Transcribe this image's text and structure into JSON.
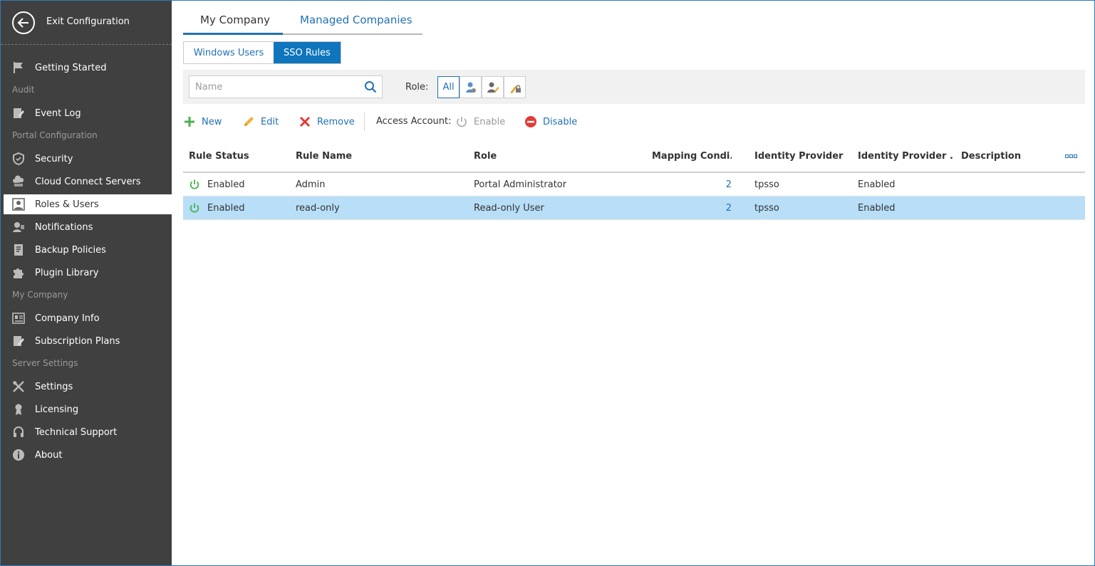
{
  "sidebar": {
    "exit_label": "Exit Configuration",
    "items": [
      {
        "label": "Getting Started",
        "icon": "flag-icon"
      },
      {
        "section": "Audit"
      },
      {
        "label": "Event Log",
        "icon": "event-log-icon"
      },
      {
        "section": "Portal Configuration"
      },
      {
        "label": "Security",
        "icon": "shield-icon"
      },
      {
        "label": "Cloud Connect Servers",
        "icon": "cloud-server-icon"
      },
      {
        "label": "Roles & Users",
        "icon": "user-card-icon",
        "active": true
      },
      {
        "label": "Notifications",
        "icon": "notification-icon"
      },
      {
        "label": "Backup Policies",
        "icon": "policy-icon"
      },
      {
        "label": "Plugin Library",
        "icon": "puzzle-icon"
      },
      {
        "section": "My Company"
      },
      {
        "label": "Company Info",
        "icon": "company-info-icon"
      },
      {
        "label": "Subscription Plans",
        "icon": "subscription-icon"
      },
      {
        "section": "Server Settings"
      },
      {
        "label": "Settings",
        "icon": "tools-icon"
      },
      {
        "label": "Licensing",
        "icon": "license-icon"
      },
      {
        "label": "Technical Support",
        "icon": "headset-icon"
      },
      {
        "label": "About",
        "icon": "info-icon"
      }
    ]
  },
  "tabs": {
    "my_company": "My Company",
    "managed_companies": "Managed Companies"
  },
  "subtabs": {
    "windows_users": "Windows Users",
    "sso_rules": "SSO Rules"
  },
  "filter": {
    "search_placeholder": "Name",
    "role_label": "Role:",
    "all_label": "All"
  },
  "toolbar": {
    "new": "New",
    "edit": "Edit",
    "remove": "Remove",
    "access_account_label": "Access Account:",
    "enable": "Enable",
    "disable": "Disable"
  },
  "colors": {
    "accent": "#0f75bc",
    "sidebar": "#404040",
    "selected_row": "#b8def8",
    "enabled_green": "#4caf50",
    "remove_red": "#e53935"
  },
  "grid": {
    "columns": [
      "Rule Status",
      "Rule Name",
      "Role",
      "Mapping Condi...",
      "Identity Provider",
      "Identity Provider ...",
      "Description"
    ],
    "rows": [
      {
        "status": "Enabled",
        "name": "Admin",
        "role": "Portal Administrator",
        "mapping": "2",
        "idp": "tpsso",
        "idp_status": "Enabled",
        "description": ""
      },
      {
        "status": "Enabled",
        "name": "read-only",
        "role": "Read-only User",
        "mapping": "2",
        "idp": "tpsso",
        "idp_status": "Enabled",
        "description": "",
        "selected": true
      }
    ]
  }
}
